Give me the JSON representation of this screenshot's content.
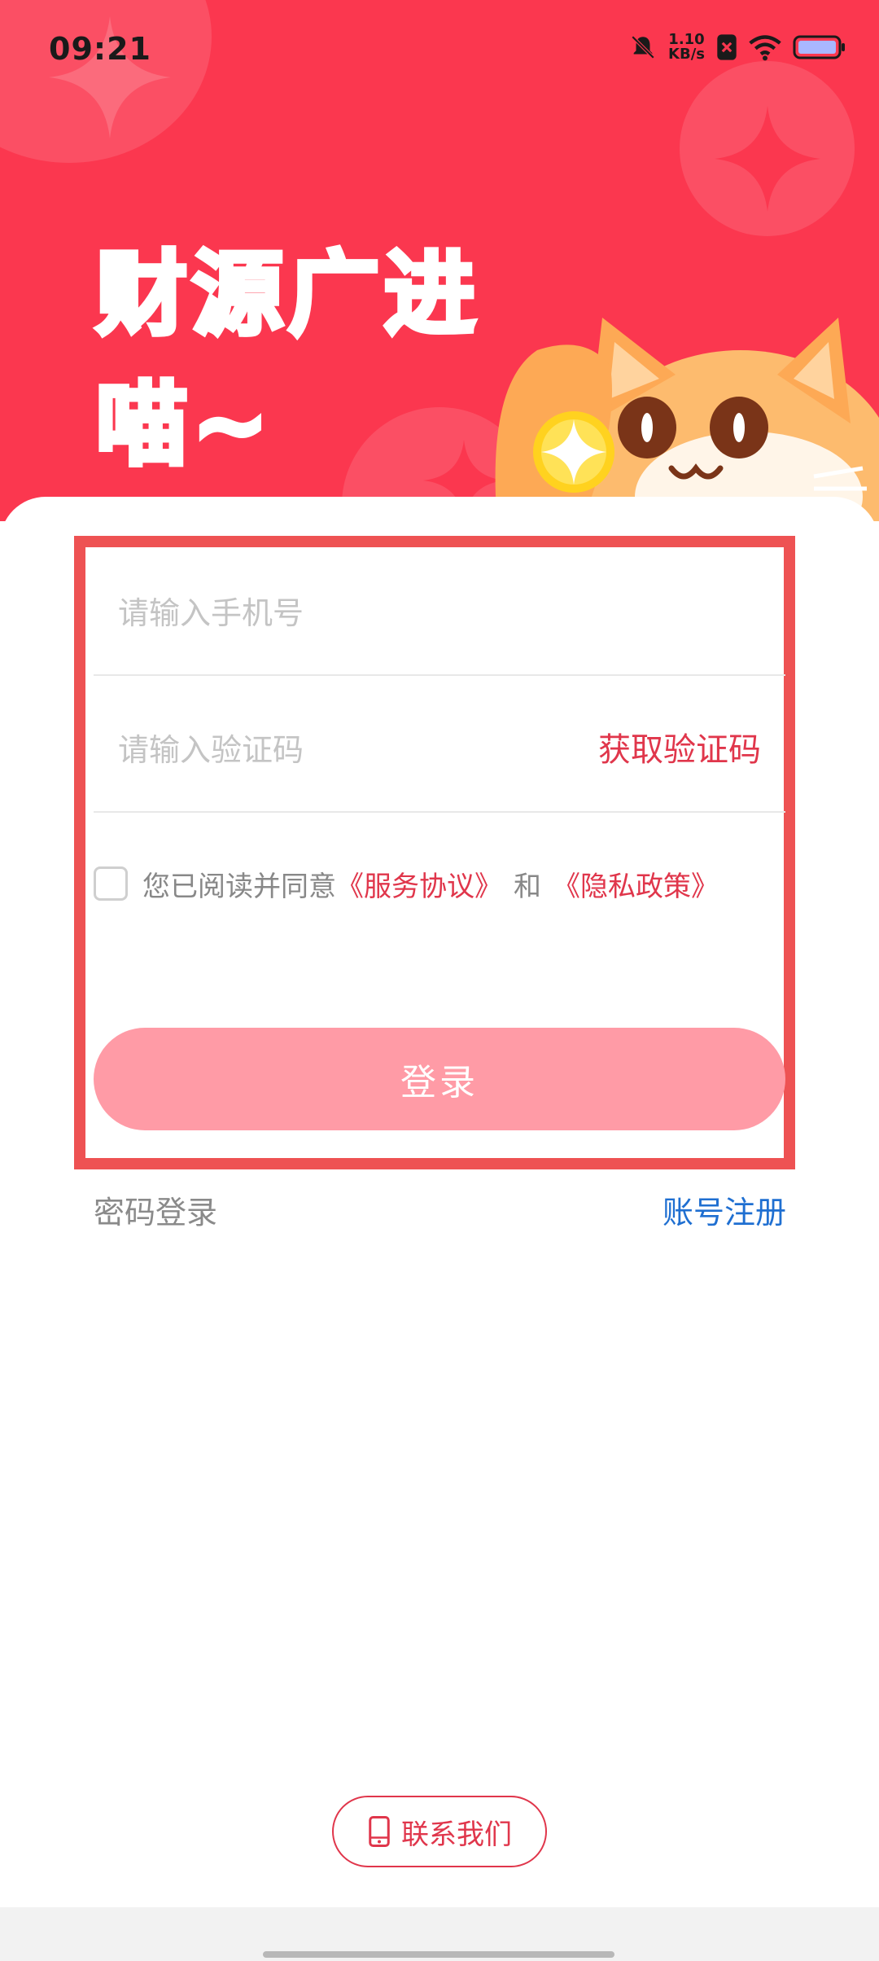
{
  "status_bar": {
    "time": "09:21",
    "net_speed_value": "1.10",
    "net_speed_unit": "KB/s",
    "icons": [
      "mute-icon",
      "sim-icon",
      "wifi-icon",
      "battery-icon"
    ]
  },
  "hero": {
    "line1": "财源广进",
    "line2": "喵~"
  },
  "form": {
    "phone_placeholder": "请输入手机号",
    "code_placeholder": "请输入验证码",
    "get_code_label": "获取验证码",
    "agreement_prefix": "您已阅读并同意",
    "service_agreement": "《服务协议》",
    "and_text": "和",
    "privacy_policy": "《隐私政策》",
    "login_label": "登录"
  },
  "links": {
    "password_login": "密码登录",
    "register": "账号注册"
  },
  "footer": {
    "contact_label": "联系我们"
  },
  "colors": {
    "brand_red": "#fb374f",
    "link_red": "#e0364b",
    "login_button": "#ff9ba6",
    "register_blue": "#1f6fd1",
    "highlight_box": "#ee5253"
  }
}
